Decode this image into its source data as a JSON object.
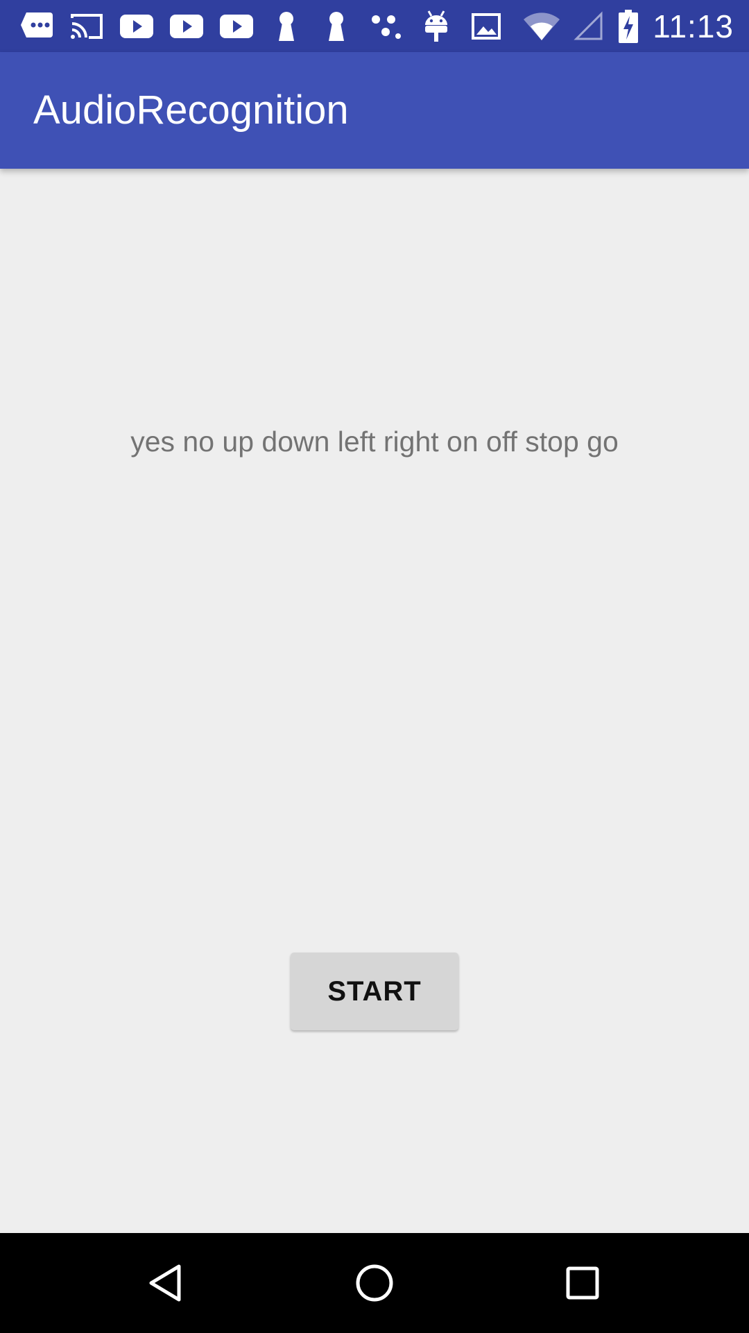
{
  "status_bar": {
    "time": "11:13",
    "left_icons": [
      "chat-icon",
      "cast-icon",
      "youtube-icon",
      "youtube-icon",
      "youtube-icon",
      "keyhole-icon",
      "keyhole-icon",
      "dots-icon",
      "android-icon",
      "image-icon"
    ],
    "right_icons": [
      "wifi-icon",
      "signal-icon",
      "battery-charging-icon"
    ]
  },
  "app_bar": {
    "title": "AudioRecognition"
  },
  "main": {
    "words": "yes no up down left right on off stop go",
    "start_label": "START"
  },
  "nav_bar": {
    "icons": [
      "back-icon",
      "home-icon",
      "recents-icon"
    ]
  },
  "colors": {
    "status_bar": "#303F9F",
    "app_bar": "#3F51B5",
    "background": "#EEEEEE",
    "button": "#D6D6D6",
    "nav_bar": "#000000"
  }
}
